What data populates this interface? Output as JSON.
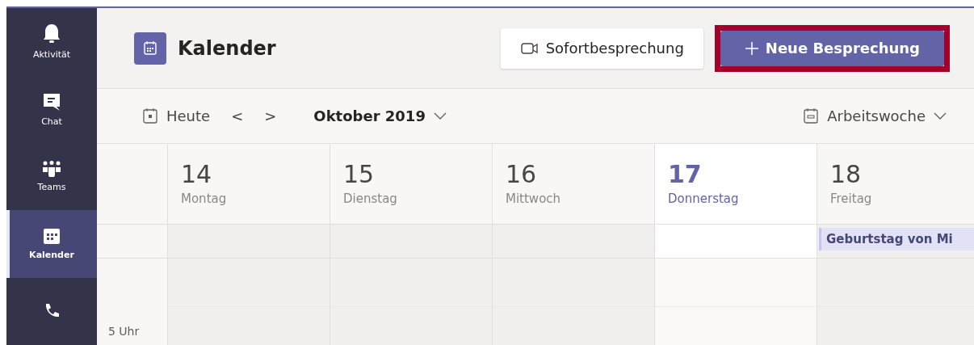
{
  "sidebar": {
    "items": [
      {
        "label": "Aktivität",
        "selected": false
      },
      {
        "label": "Chat",
        "selected": false
      },
      {
        "label": "Teams",
        "selected": false
      },
      {
        "label": "Kalender",
        "selected": true
      },
      {
        "selected": false
      }
    ]
  },
  "header": {
    "title": "Kalender",
    "buttons": [
      {
        "kind": "secondary",
        "label": "Sofortbesprechung",
        "highlighted": false
      },
      {
        "kind": "primary",
        "label": "Neue Besprechung",
        "highlighted": true
      }
    ]
  },
  "toolbar": {
    "today": "Heute",
    "prev": "<",
    "next": ">",
    "month": "Oktober 2019",
    "view": "Arbeitswoche"
  },
  "days": [
    {
      "number": "14",
      "name": "Montag",
      "selected": false
    },
    {
      "number": "15",
      "name": "Dienstag",
      "selected": false
    },
    {
      "number": "16",
      "name": "Mittwoch",
      "selected": false
    },
    {
      "number": "17",
      "name": "Donnerstag",
      "selected": true
    },
    {
      "number": "18",
      "name": "Freitag",
      "selected": false,
      "events": [
        "Geburtstag von Mi"
      ]
    }
  ],
  "time_labels": [
    "5 Uhr"
  ]
}
